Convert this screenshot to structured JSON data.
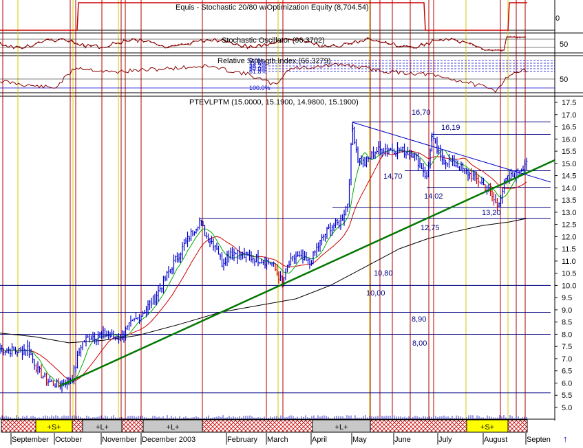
{
  "panels": {
    "equity": {
      "title": "Equis - Stochastic 20/80 w/Optimization Equity (8,704.54)",
      "axis_ticks": [
        "0"
      ]
    },
    "stochastic": {
      "title": "Stochastic Oscillator (96.3702)",
      "axis_ticks": [
        "50"
      ]
    },
    "rsi": {
      "title": "Relative Strength Index (66.3279)",
      "axis_ticks": [
        "50"
      ],
      "fib_labels": [
        "0.0%",
        "23.6%",
        "38.2%",
        "50.0%",
        "61.8%",
        "100.0%"
      ]
    },
    "price": {
      "title": "PTEVLPTM (15.0000, 15.1900, 14.9800, 15.1900)"
    }
  },
  "colors": {
    "price_bars": "#0000cc",
    "down_bars": "#cc0000",
    "ma_short": "#00aa00",
    "ma_mid": "#cc0000",
    "ma_long": "#000000",
    "trendline": "#007700",
    "event_red": "#b00000",
    "event_yellow": "#d4c800",
    "level_lines": "#000080",
    "label_text": "#000080"
  },
  "chart_data": {
    "type": "line",
    "series": [
      {
        "name": "PTEVLPTM",
        "style": "ohlc",
        "points": [
          [
            "Sep",
            7.3
          ],
          [
            "early Oct",
            5.9
          ],
          [
            "Oct",
            7.8
          ],
          [
            "Nov",
            7.9
          ],
          [
            "Dec",
            9.8
          ],
          [
            "Jan",
            12.6
          ],
          [
            "Feb",
            11.0
          ],
          [
            "early Mar",
            10.1
          ],
          [
            "Mar",
            10.9
          ],
          [
            "Apr",
            12.0
          ],
          [
            "May",
            16.7
          ],
          [
            "Jun",
            15.5
          ],
          [
            "late Jun",
            16.19
          ],
          [
            "Jul",
            15.0
          ],
          [
            "Aug",
            13.2
          ],
          [
            "late Aug",
            15.19
          ]
        ]
      }
    ],
    "ylim": [
      4.6,
      17.6
    ],
    "y_ticks": [
      "5.0",
      "5.5",
      "6.0",
      "6.5",
      "7.0",
      "7.5",
      "8.0",
      "8.5",
      "9.0",
      "9.5",
      "10.0",
      "10.5",
      "11.0",
      "11.5",
      "12.0",
      "12.5",
      "13.0",
      "13.5",
      "14.0",
      "14.5",
      "15.0",
      "15.5",
      "16.0",
      "16.5",
      "17.0",
      "17.5"
    ],
    "x_labels": [
      "September",
      "October",
      "November",
      "December 2003",
      "February",
      "March",
      "April",
      "May",
      "June",
      "July",
      "August",
      "Septen"
    ],
    "level_labels": [
      "16,70",
      "16,19",
      "14,70",
      "14,02",
      "13,20",
      "12,75",
      "10,80",
      "10,00",
      "8,90",
      "8,00"
    ],
    "signal_labels": [
      "+S+",
      "+L+",
      "+L+",
      "+L+",
      "+S+"
    ],
    "grid": false
  }
}
